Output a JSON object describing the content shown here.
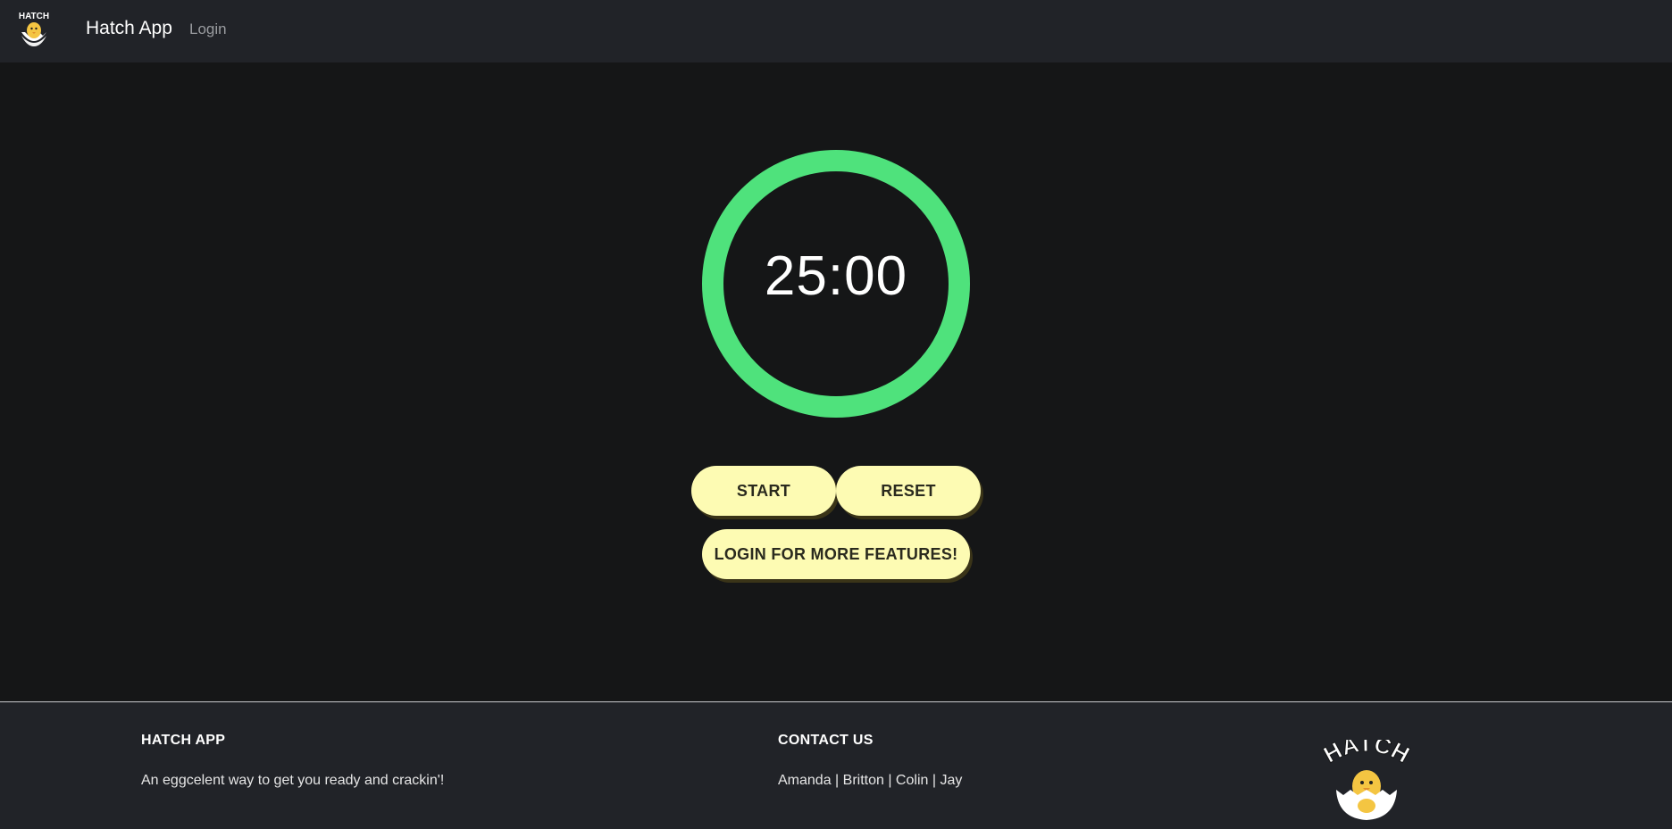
{
  "nav": {
    "brand": "Hatch App",
    "login_link": "Login",
    "logo_text": "HATCH"
  },
  "timer": {
    "display": "25:00",
    "progress": 1.0,
    "ring_color": "#4fe27c"
  },
  "controls": {
    "start_label": "START",
    "reset_label": "RESET",
    "login_features_label": "LOGIN FOR MORE FEATURES!",
    "button_color": "#fdfbb3"
  },
  "footer": {
    "about_heading": "HATCH APP",
    "about_text": "An eggcelent way to get you ready and crackin'!",
    "contact_heading": "CONTACT US",
    "contact_text": "Amanda | Britton | Colin | Jay",
    "logo_text": "HATCH"
  },
  "icons": {
    "nav_logo": "hatch-chick-logo-icon",
    "footer_logo": "hatch-chick-logo-icon"
  }
}
